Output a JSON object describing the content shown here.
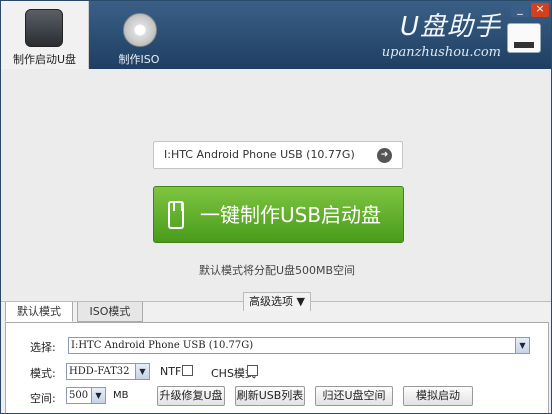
{
  "tabs": [
    {
      "label": "制作启动U盘",
      "active": true,
      "icon": "usb-drive-icon"
    },
    {
      "label": "制作ISO",
      "active": false,
      "icon": "disc-icon"
    }
  ],
  "brand": {
    "title": "U盘助手",
    "subtitle": "upanzhushou.com"
  },
  "window": {
    "minimize_symbol": "_",
    "close_symbol": "×"
  },
  "main": {
    "drive": "I:HTC Android Phone USB (10.77G)",
    "make_button": "一键制作USB启动盘",
    "hint": "默认模式将分配U盘500MB空间",
    "advanced": "高级选项 ▼"
  },
  "advanced_panel": {
    "tabs": [
      "默认模式",
      "ISO模式"
    ],
    "select_label": "选择:",
    "select_value": "I:HTC Android Phone USB (10.77G)",
    "mode_label": "模式:",
    "mode_value": "HDD-FAT32",
    "ntfs_label": "NTFS",
    "chs_label": "CHS模式",
    "space_label": "空间:",
    "space_value": "500",
    "space_unit": "MB",
    "buttons": [
      "升级修复U盘",
      "刷新USB列表",
      "归还U盘空间",
      "模拟启动"
    ]
  },
  "colors": {
    "header": "#2b4f76",
    "accent_green": "#5aad2a",
    "close": "#d2401f"
  }
}
